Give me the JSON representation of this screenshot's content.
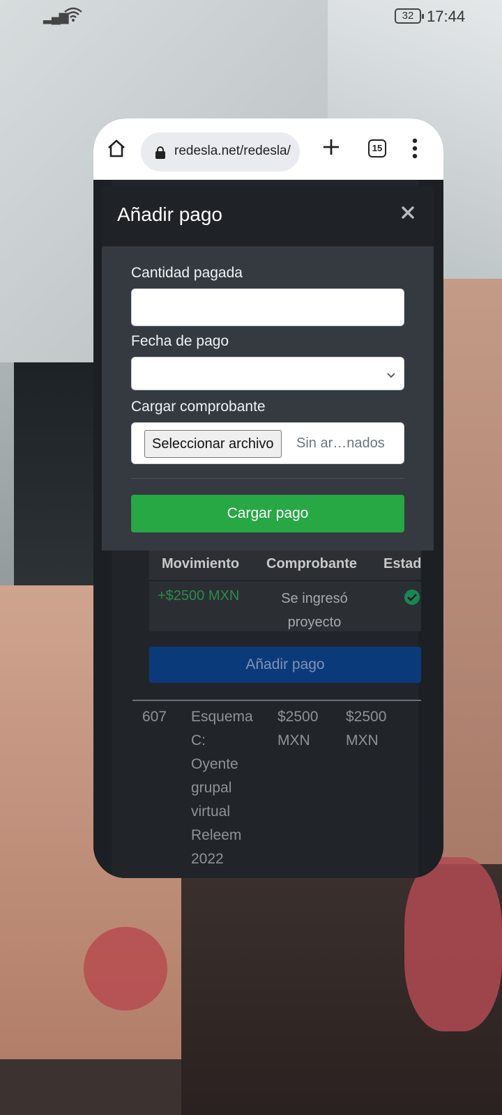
{
  "status_bar": {
    "battery": "32",
    "time": "17:44"
  },
  "browser": {
    "url": "redesla.net/redesla/",
    "tab_count": "15"
  },
  "modal": {
    "title": "Añadir pago",
    "amount_label": "Cantidad pagada",
    "amount_value": "",
    "date_label": "Fecha de pago",
    "date_value": "",
    "receipt_label": "Cargar comprobante",
    "file_button": "Seleccionar archivo",
    "file_status": "Sin ar…nados",
    "submit_label": "Cargar pago"
  },
  "payments_table": {
    "headers": [
      "Movimiento",
      "Comprobante",
      "Estad"
    ],
    "rows": [
      {
        "movement": "+$2500 MXN",
        "receipt_line1": "Se ingresó",
        "receipt_line2": "proyecto"
      }
    ],
    "add_button": "Añadir pago"
  },
  "project_row": {
    "id": "607",
    "scheme_lines": [
      "Esquema",
      "C:",
      "Oyente",
      "grupal",
      "virtual",
      "Releem",
      "2022"
    ],
    "price_lines": [
      "$2500",
      "MXN"
    ],
    "paid_lines": [
      "$2500",
      "MXN"
    ]
  },
  "colors": {
    "success": "#28a745",
    "primary": "#0a3a7a",
    "modal_bg": "#343a40"
  }
}
